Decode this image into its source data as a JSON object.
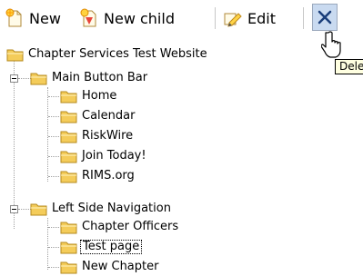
{
  "toolbar": {
    "new_label": "New",
    "new_child_label": "New child",
    "edit_label": "Edit",
    "delete_tooltip": "Delete"
  },
  "tree": {
    "root": "Chapter Services Test Website",
    "main_button_bar": {
      "label": "Main Button Bar",
      "children": [
        "Home",
        "Calendar",
        "RiskWire",
        "Join Today!",
        "RIMS.org"
      ]
    },
    "left_side_navigation": {
      "label": "Left Side Navigation",
      "children": [
        "Chapter Officers",
        "Test page",
        "New Chapter"
      ]
    },
    "selected": "Test page"
  },
  "colors": {
    "folder_body": "#f4cc5a",
    "folder_outline": "#b48a1e",
    "delete_hover_bg": "#c9daf0",
    "tooltip_bg": "#ffffe1",
    "tree_lines": "#a0a0a0"
  }
}
